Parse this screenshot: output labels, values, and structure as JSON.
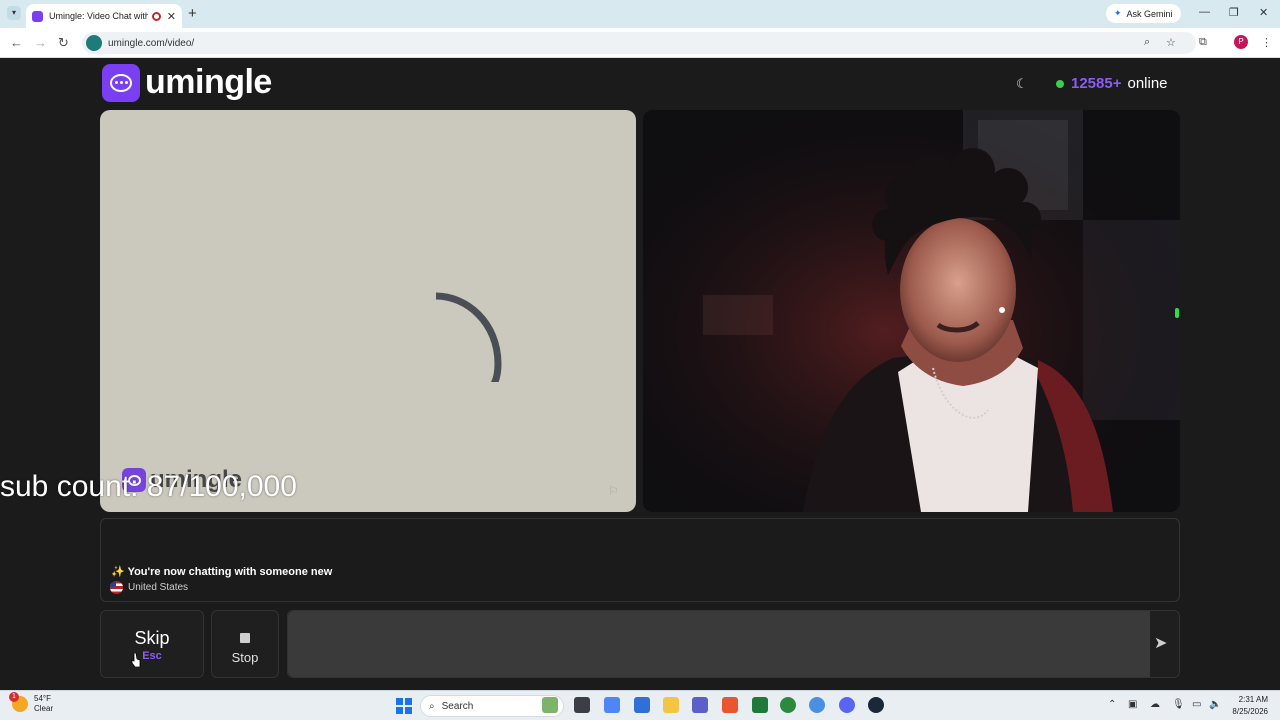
{
  "browser": {
    "tab_title": "Umingle: Video Chat with S",
    "new_tab": "+",
    "tab_close": "✕",
    "ask_gemini": "Ask Gemini",
    "url": "umingle.com/video/",
    "profile_initial": "P"
  },
  "header": {
    "brand": "umingle",
    "online_count": "12585+",
    "online_label": "online"
  },
  "left_video": {
    "watermark": "umingle"
  },
  "overlay": {
    "sub_count": "sub count: 87/100,000"
  },
  "chat": {
    "sparkle": "✨",
    "message": "You're now chatting with someone new",
    "country": "United States"
  },
  "controls": {
    "skip_label": "Skip",
    "skip_key": "Esc",
    "stop_label": "Stop",
    "message_placeholder": "",
    "send_icon": "➤"
  },
  "taskbar": {
    "temperature": "54°F",
    "condition": "Clear",
    "weather_badge": "1",
    "search_label": "Search",
    "time": "2:31 AM",
    "date": "8/25/2026"
  },
  "colors": {
    "accent": "#8b5cf6",
    "brand": "#7b3ff2",
    "online_dot": "#3ccf4e"
  }
}
